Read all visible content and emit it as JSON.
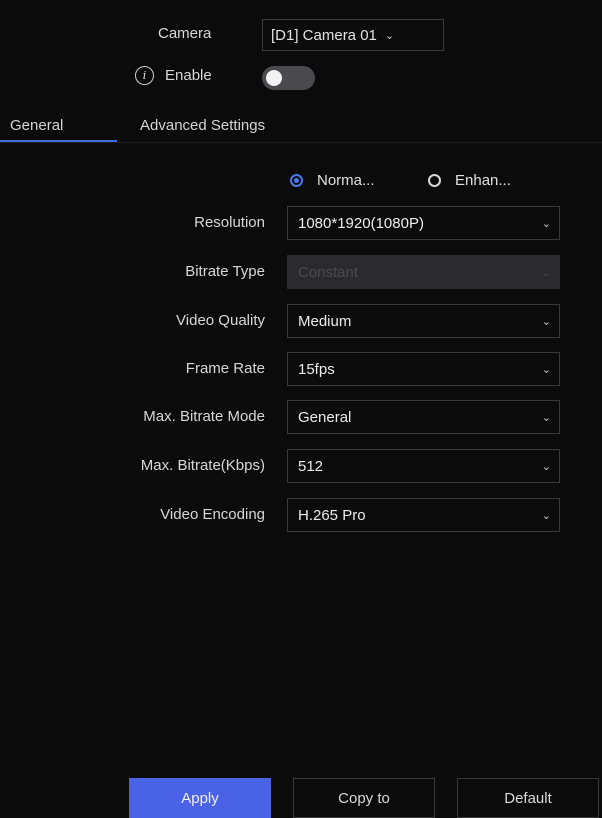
{
  "camera": {
    "label": "Camera",
    "selected": "[D1] Camera 01",
    "chevron": "⌄"
  },
  "enable": {
    "label": "Enable",
    "info_icon": "i",
    "on": false
  },
  "tabs": [
    {
      "label": "General",
      "active": true
    },
    {
      "label": "Advanced Settings",
      "active": false
    }
  ],
  "stream_type": {
    "options": [
      {
        "label": "Norma...",
        "selected": true
      },
      {
        "label": "Enhan...",
        "selected": false
      }
    ]
  },
  "fields": [
    {
      "label": "Resolution",
      "value": "1080*1920(1080P)",
      "disabled": false
    },
    {
      "label": "Bitrate Type",
      "value": "Constant",
      "disabled": true
    },
    {
      "label": "Video Quality",
      "value": "Medium",
      "disabled": false
    },
    {
      "label": "Frame Rate",
      "value": "15fps",
      "disabled": false
    },
    {
      "label": "Max. Bitrate Mode",
      "value": "General",
      "disabled": false
    },
    {
      "label": "Max. Bitrate(Kbps)",
      "value": "512",
      "disabled": false
    },
    {
      "label": "Video Encoding",
      "value": "H.265 Pro",
      "disabled": false
    }
  ],
  "buttons": {
    "apply": "Apply",
    "copy_to": "Copy to",
    "default": "Default"
  },
  "colors": {
    "accent": "#4a63e6",
    "tab_underline": "#3f6fe0",
    "background": "#0b0b0c"
  }
}
